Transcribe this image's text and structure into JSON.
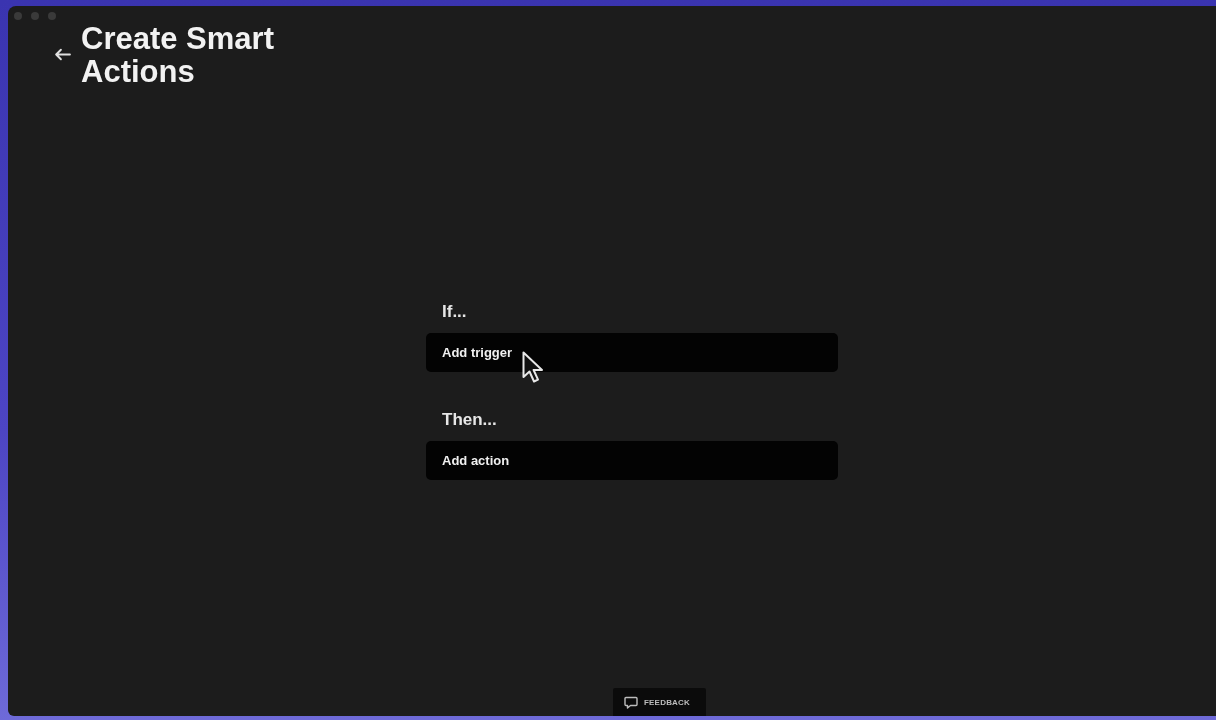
{
  "page": {
    "title": "Create Smart Actions"
  },
  "sections": [
    {
      "heading": "If...",
      "button": "Add trigger"
    },
    {
      "heading": "Then...",
      "button": "Add action"
    }
  ],
  "footer": {
    "feedback_button": "FEEDBACK"
  }
}
